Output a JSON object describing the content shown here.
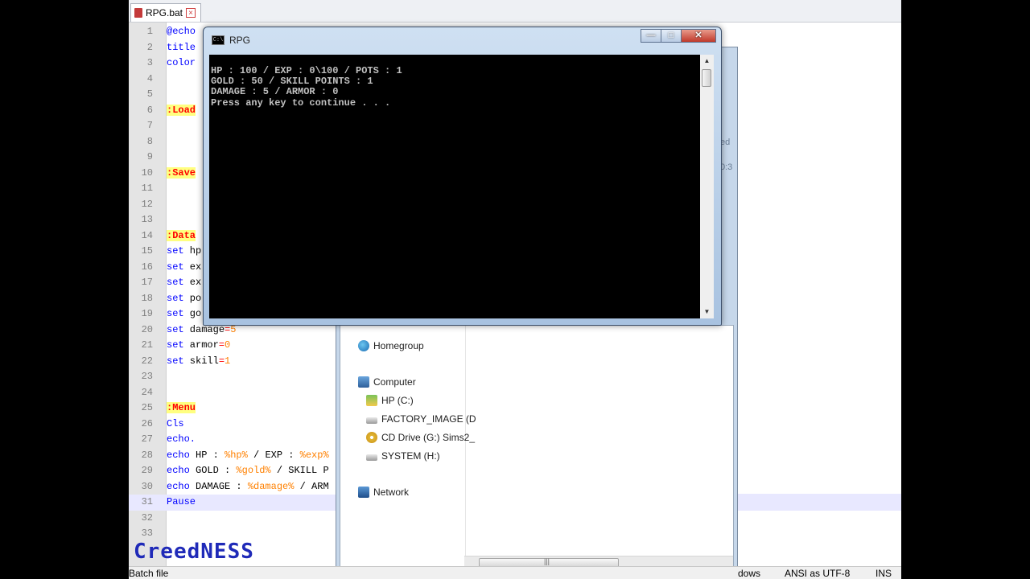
{
  "editor": {
    "tab_label": "RPG.bat",
    "tab_close": "×",
    "lines": [
      {
        "n": "1",
        "parts": [
          {
            "t": "@echo",
            "c": "kw"
          }
        ]
      },
      {
        "n": "2",
        "parts": [
          {
            "t": "title",
            "c": "kw"
          }
        ]
      },
      {
        "n": "3",
        "parts": [
          {
            "t": "color",
            "c": "kw"
          }
        ]
      },
      {
        "n": "4",
        "parts": []
      },
      {
        "n": "5",
        "parts": []
      },
      {
        "n": "6",
        "parts": [
          {
            "t": ":Load",
            "c": "lbl"
          }
        ]
      },
      {
        "n": "7",
        "parts": []
      },
      {
        "n": "8",
        "parts": []
      },
      {
        "n": "9",
        "parts": []
      },
      {
        "n": "10",
        "parts": [
          {
            "t": ":Save",
            "c": "lbl"
          }
        ]
      },
      {
        "n": "11",
        "parts": []
      },
      {
        "n": "12",
        "parts": []
      },
      {
        "n": "13",
        "parts": []
      },
      {
        "n": "14",
        "parts": [
          {
            "t": ":Data",
            "c": "lbl"
          }
        ]
      },
      {
        "n": "15",
        "parts": [
          {
            "t": "set",
            "c": "kw"
          },
          {
            "t": " hp",
            "c": "txt"
          }
        ]
      },
      {
        "n": "16",
        "parts": [
          {
            "t": "set",
            "c": "kw"
          },
          {
            "t": " ex",
            "c": "txt"
          }
        ]
      },
      {
        "n": "17",
        "parts": [
          {
            "t": "set",
            "c": "kw"
          },
          {
            "t": " ex",
            "c": "txt"
          }
        ]
      },
      {
        "n": "18",
        "parts": [
          {
            "t": "set",
            "c": "kw"
          },
          {
            "t": " po",
            "c": "txt"
          }
        ]
      },
      {
        "n": "19",
        "parts": [
          {
            "t": "set",
            "c": "kw"
          },
          {
            "t": " go",
            "c": "txt"
          }
        ]
      },
      {
        "n": "20",
        "parts": [
          {
            "t": "set",
            "c": "kw"
          },
          {
            "t": " damage",
            "c": "txt"
          },
          {
            "t": "=",
            "c": "op"
          },
          {
            "t": "5",
            "c": "num"
          }
        ]
      },
      {
        "n": "21",
        "parts": [
          {
            "t": "set",
            "c": "kw"
          },
          {
            "t": " armor",
            "c": "txt"
          },
          {
            "t": "=",
            "c": "op"
          },
          {
            "t": "0",
            "c": "num"
          }
        ]
      },
      {
        "n": "22",
        "parts": [
          {
            "t": "set",
            "c": "kw"
          },
          {
            "t": " skill",
            "c": "txt"
          },
          {
            "t": "=",
            "c": "op"
          },
          {
            "t": "1",
            "c": "num"
          }
        ]
      },
      {
        "n": "23",
        "parts": []
      },
      {
        "n": "24",
        "parts": []
      },
      {
        "n": "25",
        "parts": [
          {
            "t": ":Menu",
            "c": "lbl"
          }
        ]
      },
      {
        "n": "26",
        "parts": [
          {
            "t": "Cls",
            "c": "kw"
          }
        ]
      },
      {
        "n": "27",
        "parts": [
          {
            "t": "echo.",
            "c": "kw"
          }
        ]
      },
      {
        "n": "28",
        "parts": [
          {
            "t": "echo",
            "c": "kw"
          },
          {
            "t": " HP : ",
            "c": "txt"
          },
          {
            "t": "%hp%",
            "c": "var"
          },
          {
            "t": " / EXP : ",
            "c": "txt"
          },
          {
            "t": "%exp%",
            "c": "var"
          }
        ]
      },
      {
        "n": "29",
        "parts": [
          {
            "t": "echo",
            "c": "kw"
          },
          {
            "t": " GOLD : ",
            "c": "txt"
          },
          {
            "t": "%gold%",
            "c": "var"
          },
          {
            "t": " / SKILL P",
            "c": "txt"
          }
        ]
      },
      {
        "n": "30",
        "parts": [
          {
            "t": "echo",
            "c": "kw"
          },
          {
            "t": " DAMAGE : ",
            "c": "txt"
          },
          {
            "t": "%damage%",
            "c": "var"
          },
          {
            "t": " / ARM",
            "c": "txt"
          }
        ]
      },
      {
        "n": "31",
        "parts": [
          {
            "t": "Pause",
            "c": "kw"
          }
        ],
        "current": true
      },
      {
        "n": "32",
        "parts": []
      },
      {
        "n": "33",
        "parts": []
      }
    ]
  },
  "statusbar": {
    "filetype": "Batch file",
    "peek": "dows",
    "encoding": "ANSI as UTF-8",
    "mode": "INS"
  },
  "explorer": {
    "peek_1": "ed",
    "peek_2": "0:3",
    "nav": [
      {
        "label": "Homegroup",
        "icon": "homegroup-icon"
      },
      {
        "label": "Computer",
        "icon": "computer-icon"
      },
      {
        "label": "HP (C:)",
        "icon": "hp-drive-icon"
      },
      {
        "label": "FACTORY_IMAGE (D",
        "icon": "drive-icon"
      },
      {
        "label": "CD Drive (G:) Sims2_",
        "icon": "cd-drive-icon"
      },
      {
        "label": "SYSTEM (H:)",
        "icon": "drive-icon"
      },
      {
        "label": "Network",
        "icon": "network-icon"
      }
    ],
    "scroll_grip": "|||"
  },
  "cmd": {
    "title": "RPG",
    "icon_text": "C:\\",
    "minimize": "—",
    "maximize": "□",
    "close": "✕",
    "output": [
      "HP : 100 / EXP : 0\\100 / POTS : 1",
      "GOLD : 50 / SKILL POINTS : 1",
      "DAMAGE : 5 / ARMOR : 0",
      "Press any key to continue . . ."
    ],
    "scroll_up": "▲",
    "scroll_down": "▼"
  },
  "watermark": "CreedNESS",
  "colors": {
    "keyword": "#0000ff",
    "label_bg": "#ffff80",
    "label_fg": "#ff0000",
    "variable": "#ff8000",
    "current_line": "#e8e8ff"
  }
}
